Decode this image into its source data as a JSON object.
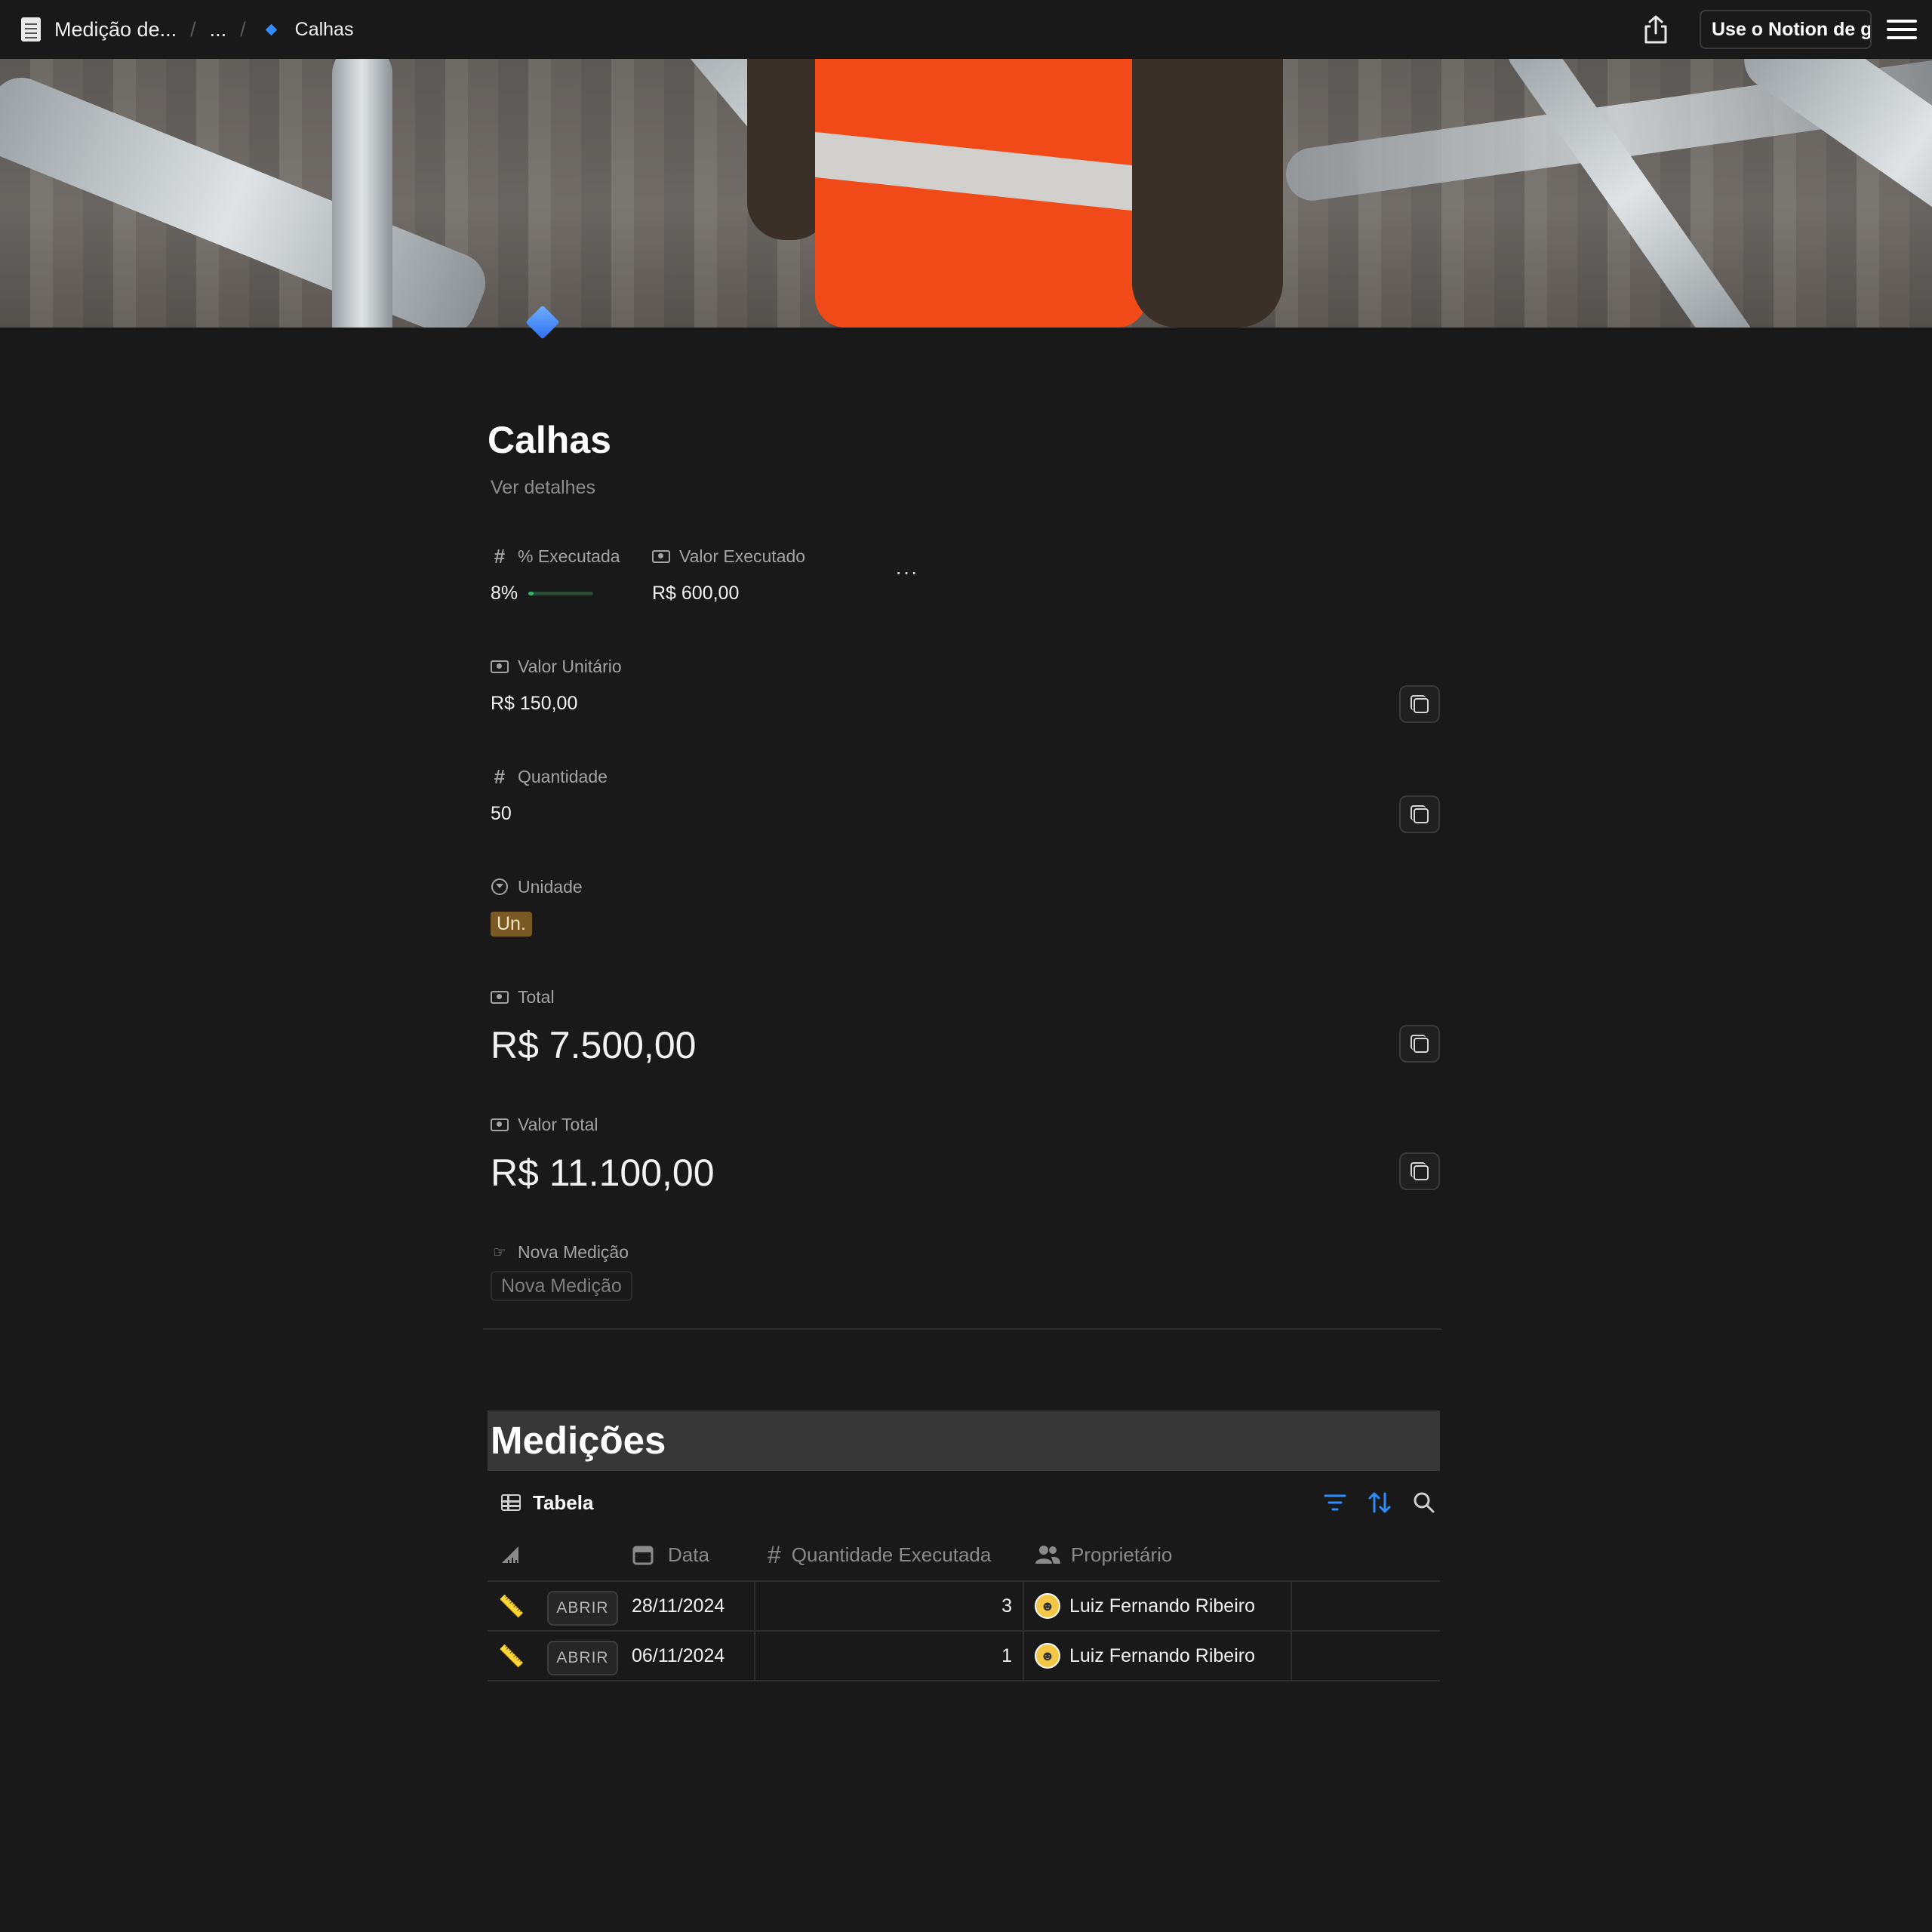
{
  "topbar": {
    "breadcrumb": [
      {
        "label": "Medição de...",
        "icon": "page-doc-icon"
      },
      {
        "label": "..."
      },
      {
        "label": "Calhas",
        "icon": "blue-diamond-icon"
      }
    ],
    "separator": "/",
    "notion_button": "Use o Notion de g"
  },
  "page": {
    "title": "Calhas",
    "subtitle": "Ver detalhes"
  },
  "properties": {
    "percent_executada": {
      "label": "% Executada",
      "value": "8%",
      "progress": 0.08
    },
    "valor_executado": {
      "label": "Valor Executado",
      "value": "R$ 600,00"
    },
    "more": "···",
    "valor_unitario": {
      "label": "Valor Unitário",
      "value": "R$ 150,00"
    },
    "quantidade": {
      "label": "Quantidade",
      "value": "50"
    },
    "unidade": {
      "label": "Unidade",
      "value": "Un.",
      "color": "#7a5a24"
    },
    "total": {
      "label": "Total",
      "value": "R$ 7.500,00"
    },
    "valor_total": {
      "label": "Valor Total",
      "value": "R$ 11.100,00"
    },
    "nova_medicao": {
      "label": "Nova Medição",
      "button": "Nova Medição"
    }
  },
  "section": {
    "heading": "Medições",
    "view_tab": "Tabela"
  },
  "table": {
    "columns": [
      "",
      "Data",
      "Quantidade Executada",
      "Proprietário"
    ],
    "rows": [
      {
        "open": "ABRIR",
        "date": "28/11/2024",
        "qty": "3",
        "owner": "Luiz Fernando Ribeiro"
      },
      {
        "open": "ABRIR",
        "date": "06/11/2024",
        "qty": "1",
        "owner": "Luiz Fernando Ribeiro"
      }
    ]
  },
  "colors": {
    "background": "#191919",
    "accent_blue": "#2f8cff",
    "progress_green": "#2fb363"
  }
}
